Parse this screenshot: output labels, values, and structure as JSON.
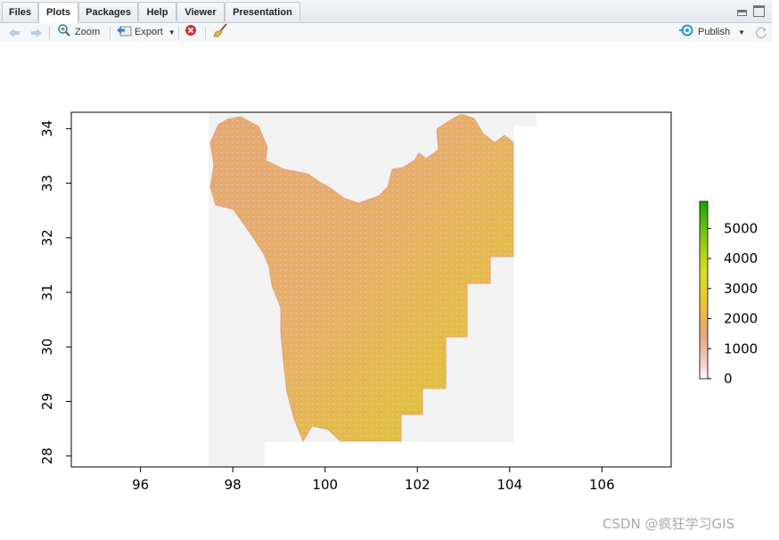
{
  "tabs": [
    {
      "label": "Files",
      "active": false
    },
    {
      "label": "Plots",
      "active": true
    },
    {
      "label": "Packages",
      "active": false
    },
    {
      "label": "Help",
      "active": false
    },
    {
      "label": "Viewer",
      "active": false
    },
    {
      "label": "Presentation",
      "active": false
    }
  ],
  "toolbar": {
    "zoom_label": "Zoom",
    "export_label": "Export",
    "publish_label": "Publish"
  },
  "chart_data": {
    "type": "heatmap",
    "title": "",
    "xlabel": "",
    "ylabel": "",
    "x_ticks": [
      "96",
      "98",
      "100",
      "102",
      "104",
      "106"
    ],
    "y_ticks": [
      "28",
      "29",
      "30",
      "31",
      "32",
      "33",
      "34"
    ],
    "xlim": [
      94.5,
      107.5
    ],
    "ylim": [
      27.8,
      34.3
    ],
    "legend": {
      "position": "right",
      "ticks": [
        "0",
        "1000",
        "2000",
        "3000",
        "4000",
        "5000"
      ],
      "range": [
        0,
        5900
      ],
      "colors": [
        "#ffffff",
        "#f2cfcc",
        "#e8a779",
        "#e8c43a",
        "#d9df22",
        "#8fcb12",
        "#1aa30c"
      ]
    }
  },
  "watermark": "CSDN @疯狂学习GIS"
}
